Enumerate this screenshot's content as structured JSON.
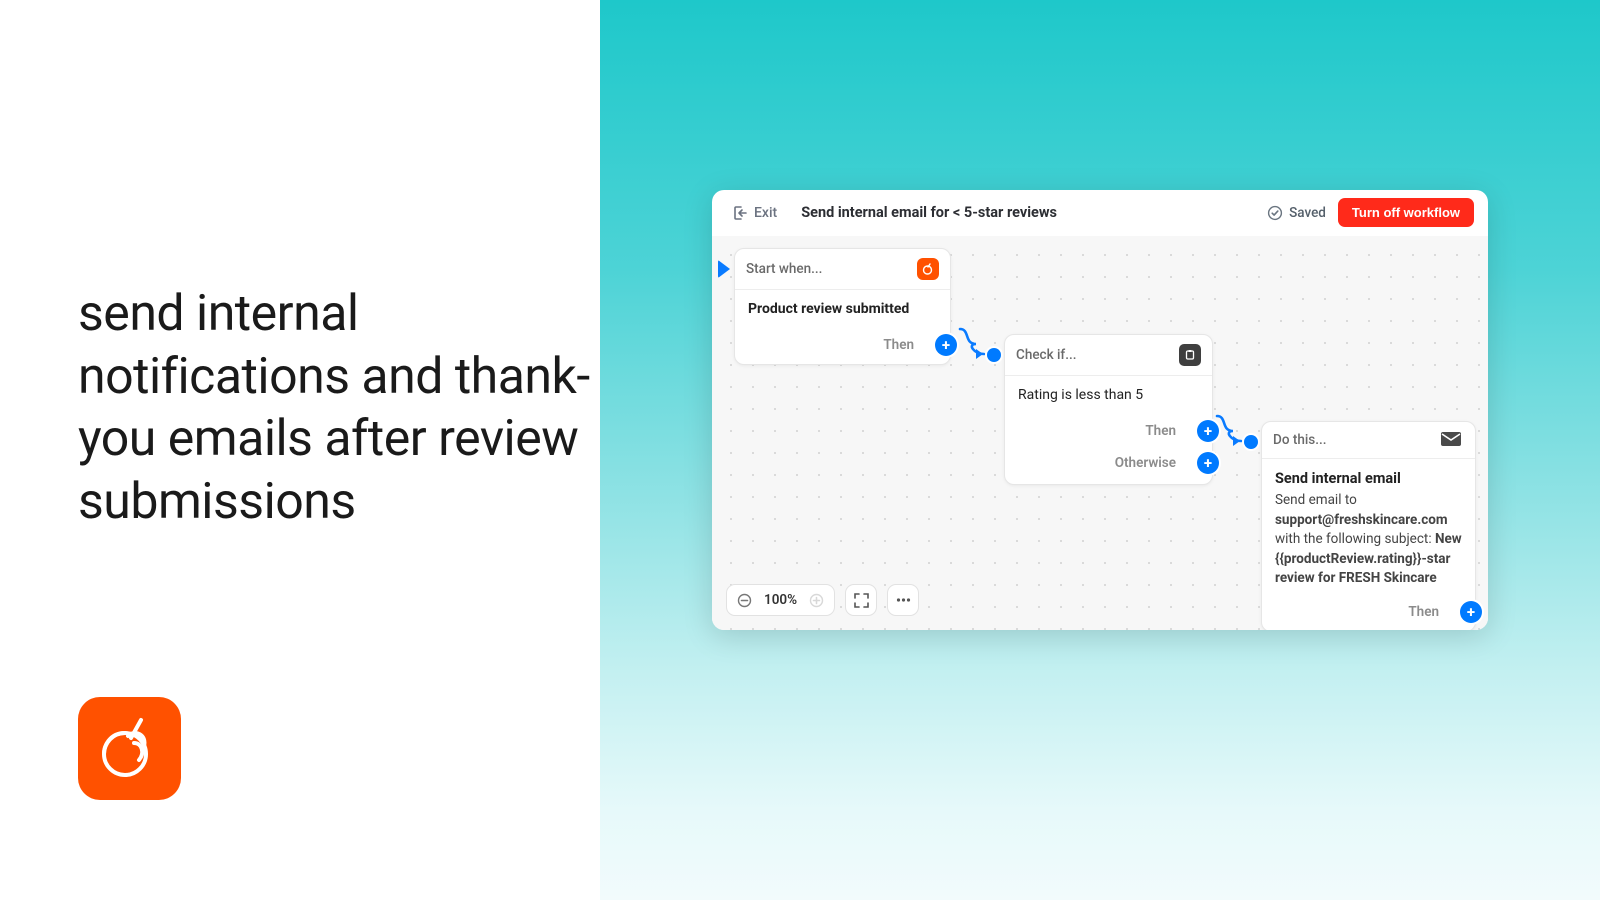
{
  "left": {
    "headline": "send internal notifications and thank-you emails after review submissions"
  },
  "header": {
    "exit": "Exit",
    "title": "Send internal email for < 5-star reviews",
    "saved": "Saved",
    "turn_off": "Turn off workflow"
  },
  "nodes": {
    "trigger": {
      "label": "Start when...",
      "body": "Product review submitted",
      "then": "Then"
    },
    "condition": {
      "label": "Check if...",
      "body": "Rating is less than 5",
      "then": "Then",
      "otherwise": "Otherwise"
    },
    "action": {
      "label": "Do this...",
      "title": "Send internal email",
      "line1_pre": "Send email to ",
      "email": "support@freshskincare.com",
      "line1_post": " with the following subject: ",
      "subject": "New {{productReview.rating}}-star review for FRESH Skincare",
      "then": "Then"
    }
  },
  "toolbar": {
    "zoom": "100%"
  }
}
